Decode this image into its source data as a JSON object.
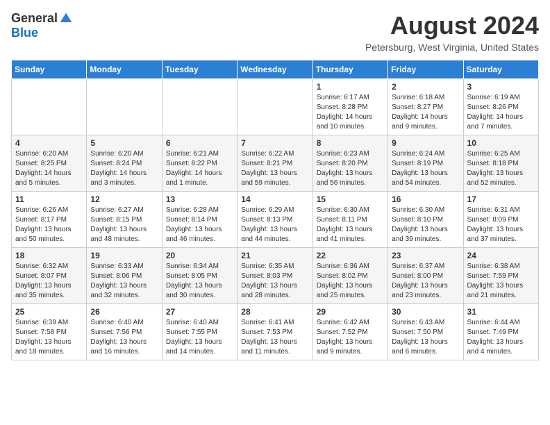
{
  "header": {
    "logo_general": "General",
    "logo_blue": "Blue",
    "month_year": "August 2024",
    "location": "Petersburg, West Virginia, United States"
  },
  "weekdays": [
    "Sunday",
    "Monday",
    "Tuesday",
    "Wednesday",
    "Thursday",
    "Friday",
    "Saturday"
  ],
  "weeks": [
    [
      {
        "day": "",
        "info": ""
      },
      {
        "day": "",
        "info": ""
      },
      {
        "day": "",
        "info": ""
      },
      {
        "day": "",
        "info": ""
      },
      {
        "day": "1",
        "info": "Sunrise: 6:17 AM\nSunset: 8:28 PM\nDaylight: 14 hours and 10 minutes."
      },
      {
        "day": "2",
        "info": "Sunrise: 6:18 AM\nSunset: 8:27 PM\nDaylight: 14 hours and 9 minutes."
      },
      {
        "day": "3",
        "info": "Sunrise: 6:19 AM\nSunset: 8:26 PM\nDaylight: 14 hours and 7 minutes."
      }
    ],
    [
      {
        "day": "4",
        "info": "Sunrise: 6:20 AM\nSunset: 8:25 PM\nDaylight: 14 hours and 5 minutes."
      },
      {
        "day": "5",
        "info": "Sunrise: 6:20 AM\nSunset: 8:24 PM\nDaylight: 14 hours and 3 minutes."
      },
      {
        "day": "6",
        "info": "Sunrise: 6:21 AM\nSunset: 8:22 PM\nDaylight: 14 hours and 1 minute."
      },
      {
        "day": "7",
        "info": "Sunrise: 6:22 AM\nSunset: 8:21 PM\nDaylight: 13 hours and 59 minutes."
      },
      {
        "day": "8",
        "info": "Sunrise: 6:23 AM\nSunset: 8:20 PM\nDaylight: 13 hours and 56 minutes."
      },
      {
        "day": "9",
        "info": "Sunrise: 6:24 AM\nSunset: 8:19 PM\nDaylight: 13 hours and 54 minutes."
      },
      {
        "day": "10",
        "info": "Sunrise: 6:25 AM\nSunset: 8:18 PM\nDaylight: 13 hours and 52 minutes."
      }
    ],
    [
      {
        "day": "11",
        "info": "Sunrise: 6:26 AM\nSunset: 8:17 PM\nDaylight: 13 hours and 50 minutes."
      },
      {
        "day": "12",
        "info": "Sunrise: 6:27 AM\nSunset: 8:15 PM\nDaylight: 13 hours and 48 minutes."
      },
      {
        "day": "13",
        "info": "Sunrise: 6:28 AM\nSunset: 8:14 PM\nDaylight: 13 hours and 46 minutes."
      },
      {
        "day": "14",
        "info": "Sunrise: 6:29 AM\nSunset: 8:13 PM\nDaylight: 13 hours and 44 minutes."
      },
      {
        "day": "15",
        "info": "Sunrise: 6:30 AM\nSunset: 8:11 PM\nDaylight: 13 hours and 41 minutes."
      },
      {
        "day": "16",
        "info": "Sunrise: 6:30 AM\nSunset: 8:10 PM\nDaylight: 13 hours and 39 minutes."
      },
      {
        "day": "17",
        "info": "Sunrise: 6:31 AM\nSunset: 8:09 PM\nDaylight: 13 hours and 37 minutes."
      }
    ],
    [
      {
        "day": "18",
        "info": "Sunrise: 6:32 AM\nSunset: 8:07 PM\nDaylight: 13 hours and 35 minutes."
      },
      {
        "day": "19",
        "info": "Sunrise: 6:33 AM\nSunset: 8:06 PM\nDaylight: 13 hours and 32 minutes."
      },
      {
        "day": "20",
        "info": "Sunrise: 6:34 AM\nSunset: 8:05 PM\nDaylight: 13 hours and 30 minutes."
      },
      {
        "day": "21",
        "info": "Sunrise: 6:35 AM\nSunset: 8:03 PM\nDaylight: 13 hours and 28 minutes."
      },
      {
        "day": "22",
        "info": "Sunrise: 6:36 AM\nSunset: 8:02 PM\nDaylight: 13 hours and 25 minutes."
      },
      {
        "day": "23",
        "info": "Sunrise: 6:37 AM\nSunset: 8:00 PM\nDaylight: 13 hours and 23 minutes."
      },
      {
        "day": "24",
        "info": "Sunrise: 6:38 AM\nSunset: 7:59 PM\nDaylight: 13 hours and 21 minutes."
      }
    ],
    [
      {
        "day": "25",
        "info": "Sunrise: 6:39 AM\nSunset: 7:58 PM\nDaylight: 13 hours and 18 minutes."
      },
      {
        "day": "26",
        "info": "Sunrise: 6:40 AM\nSunset: 7:56 PM\nDaylight: 13 hours and 16 minutes."
      },
      {
        "day": "27",
        "info": "Sunrise: 6:40 AM\nSunset: 7:55 PM\nDaylight: 13 hours and 14 minutes."
      },
      {
        "day": "28",
        "info": "Sunrise: 6:41 AM\nSunset: 7:53 PM\nDaylight: 13 hours and 11 minutes."
      },
      {
        "day": "29",
        "info": "Sunrise: 6:42 AM\nSunset: 7:52 PM\nDaylight: 13 hours and 9 minutes."
      },
      {
        "day": "30",
        "info": "Sunrise: 6:43 AM\nSunset: 7:50 PM\nDaylight: 13 hours and 6 minutes."
      },
      {
        "day": "31",
        "info": "Sunrise: 6:44 AM\nSunset: 7:49 PM\nDaylight: 13 hours and 4 minutes."
      }
    ]
  ]
}
